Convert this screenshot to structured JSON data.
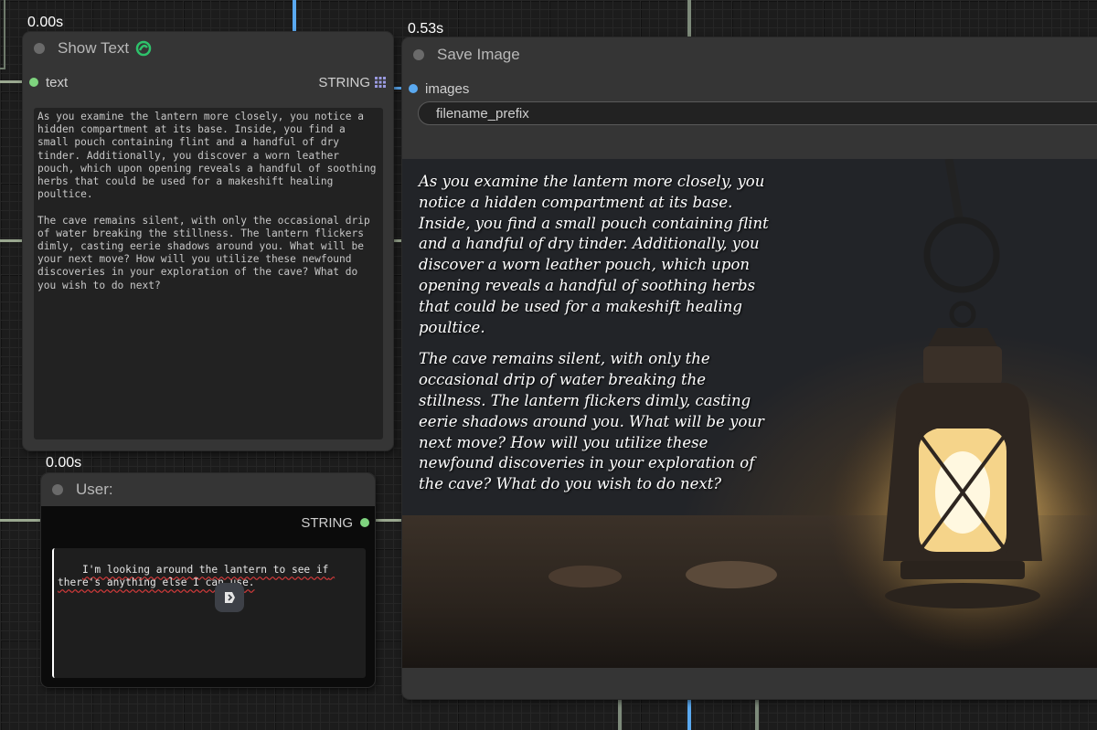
{
  "timings": {
    "show_text": "0.00s",
    "save_image": "0.53s",
    "user": "0.00s"
  },
  "show_text_node": {
    "title": "Show Text",
    "input_label": "text",
    "output_type": "STRING",
    "content": "As you examine the lantern more closely, you notice a hidden compartment at its base. Inside, you find a small pouch containing flint and a handful of dry tinder. Additionally, you discover a worn leather pouch, which upon opening reveals a handful of soothing herbs that could be used for a makeshift healing poultice.\n\nThe cave remains silent, with only the occasional drip of water breaking the stillness. The lantern flickers dimly, casting eerie shadows around you. What will be your next move? How will you utilize these newfound discoveries in your exploration of the cave? What do you wish to do next?"
  },
  "save_image_node": {
    "title": "Save Image",
    "input_label": "images",
    "widget_label": "filename_prefix",
    "image_caption_p1": "As you examine the lantern more closely, you notice a hidden compartment at its base. Inside, you find a small pouch containing flint and a handful of dry tinder. Additionally, you discover a worn leather pouch, which upon opening reveals a handful of soothing herbs that could be used for a makeshift healing poultice.",
    "image_caption_p2": "The cave remains silent, with only the occasional drip of water breaking the stillness. The lantern flickers dimly, casting eerie shadows around you. What will be your next move? How will you utilize these newfound discoveries in your exploration of the cave? What do you wish to do next?"
  },
  "user_node": {
    "title": "User:",
    "output_type": "STRING",
    "input_text": "I'm looking around the lantern to see if there's anything else I can use."
  },
  "colors": {
    "input_dot_green": "#7fd47f",
    "input_dot_blue": "#5aa9f0",
    "wire_blue": "#5aa9f0",
    "wire_green": "#9aa890",
    "swirl_icon": "#2ec26b"
  },
  "icons": {
    "show_text_title": "swirl-icon",
    "string_output": "grid-icon",
    "user_widget": "extension-icon"
  }
}
